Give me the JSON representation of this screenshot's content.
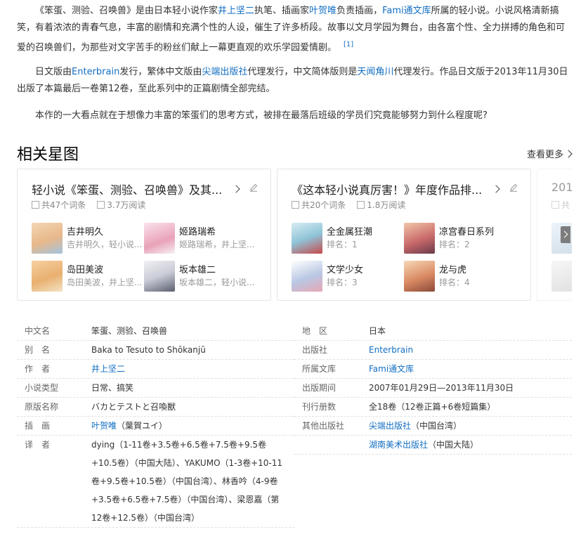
{
  "intro": {
    "p1": {
      "t1": "《笨蛋、测验、召唤兽》是由日本轻小说作家",
      "author": "井上坚二",
      "t2": "执笔、插画家",
      "illustrator": "叶贺唯",
      "t3": "负责插画，",
      "library": "Fami通文库",
      "t4": "所属的轻小说。小说风格清新搞笑，有着浓浓的青春气息，丰富的剧情和充满个性的人设，催生了许多桥段。故事以文月学园为舞台，由各富个性、全力拼搏的角色和可爱的召唤兽们，为那些对文字苦手的粉丝们献上一幕更直观的欢乐学园爱情剧。",
      "ref": "[1]"
    },
    "p2": {
      "t1": "日文版由",
      "publisher_jp": "Enterbrain",
      "t2": "发行，繁体中文版由",
      "publisher_tw": "尖端出版社",
      "t3": "代理发行，中文简体版则是",
      "publisher_cn": "天闻角川",
      "t4": "代理发行。作品日文版于2013年11月30日出版了本篇最后一卷第12卷，至此系列中的正篇剧情全部完结。"
    },
    "p3": "本作的一大看点就在于想像力丰富的笨蛋们的思考方式，被排在最落后班级的学员们究竟能够努力到什么程度呢?"
  },
  "related": {
    "title": "相关星图",
    "see_more": "查看更多",
    "cards": [
      {
        "title": "轻小说《笨蛋、测验、召唤兽》及其...",
        "entries": "共47个词条",
        "views": "3.7万阅读",
        "items": [
          {
            "name": "吉井明久",
            "sub": "吉井明久，轻小说...",
            "color": "#e8b88a"
          },
          {
            "name": "姬路瑞希",
            "sub": "姬路瑞希，井上坚...",
            "color": "#e9a2b8"
          },
          {
            "name": "岛田美波",
            "sub": "岛田美波，井上坚...",
            "color": "#e9b070"
          },
          {
            "name": "坂本雄二",
            "sub": "坂本雄二，轻小说...",
            "color": "#c9cbd6"
          }
        ]
      },
      {
        "title": "《这本轻小说真厉害！》年度作品排...",
        "entries": "共20个词条",
        "views": "1.8万阅读",
        "items": [
          {
            "name": "全金属狂潮",
            "sub": "排名：1",
            "color": "#8fc4d8"
          },
          {
            "name": "凉宫春日系列",
            "sub": "排名：2",
            "color": "#c96a6a"
          },
          {
            "name": "文学少女",
            "sub": "排名：3",
            "color": "#b9c7e3"
          },
          {
            "name": "龙与虎",
            "sub": "排名：4",
            "color": "#d98a62"
          }
        ]
      },
      {
        "title": "201",
        "entries": "共",
        "views": "",
        "items": []
      }
    ]
  },
  "info_left": [
    {
      "label": "中文名",
      "value": "笨蛋、测验、召唤兽"
    },
    {
      "label": "别　名",
      "value": "Baka to Tesuto to Shōkanjū"
    },
    {
      "label": "作　者",
      "value": "井上坚二",
      "link": true
    },
    {
      "label": "小说类型",
      "value": "日常、搞笑"
    },
    {
      "label": "原版名称",
      "value": "バカとテストと召喚獣"
    },
    {
      "label": "插　画",
      "value_link": "叶贺唯",
      "value_rest": "（葉賀ユイ）"
    },
    {
      "label": "译　者",
      "value": "dying（1-11卷+3.5卷+6.5卷+7.5卷+9.5卷+10.5卷）（中国大陆）、YAKUMO（1-3卷+10-11卷+9.5卷+10.5卷）（中国台湾）、林香吟（4-9卷+3.5卷+6.5卷+7.5卷）（中国台湾）、梁恩嘉（第12卷+12.5卷）（中国台湾）"
    }
  ],
  "info_right": [
    {
      "label": "地　区",
      "value": "日本"
    },
    {
      "label": "出版社",
      "value": "Enterbrain",
      "link": true
    },
    {
      "label": "所属文库",
      "value": "Fami通文库",
      "link": true
    },
    {
      "label": "出版期间",
      "value": "2007年01月29日—2013年11月30日"
    },
    {
      "label": "刊行册数",
      "value": "全18卷（12卷正篇+6卷短篇集）"
    },
    {
      "label": "其他出版社",
      "value_link": "尖端出版社",
      "value_rest": "（中国台湾）"
    },
    {
      "label": "",
      "value_link": "湖南美术出版社",
      "value_rest": "（中国大陆）"
    }
  ]
}
